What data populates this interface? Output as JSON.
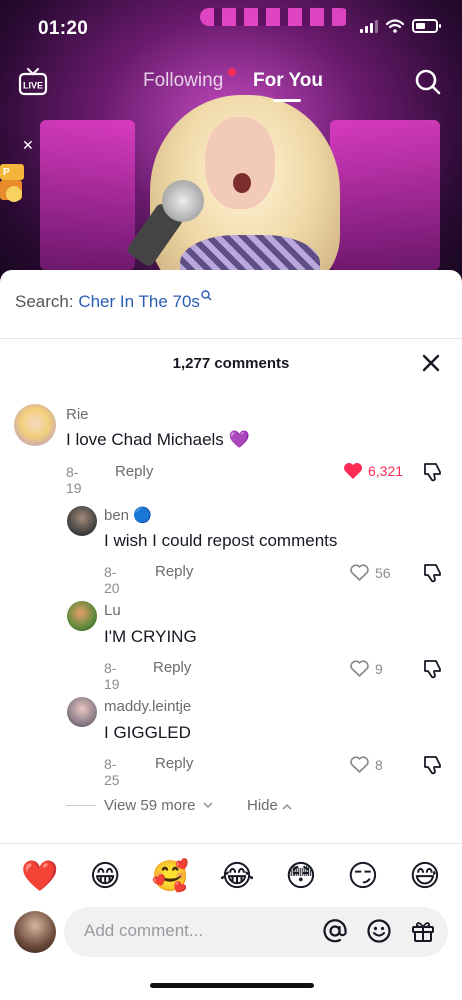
{
  "status_bar": {
    "time": "01:20"
  },
  "top_nav": {
    "live_label": "LIVE",
    "tabs": [
      {
        "label": "Following",
        "has_notification": true
      },
      {
        "label": "For You",
        "active": true
      }
    ]
  },
  "sheet": {
    "search_prefix": "Search:",
    "search_query": "Cher In The 70s",
    "comment_count_label": "1,277 comments",
    "comments": [
      {
        "user": "Rie",
        "text": "I love Chad Michaels 💜",
        "date": "8-19",
        "reply": "Reply",
        "likes": "6,321",
        "liked": true
      },
      {
        "user": "ben 🔵",
        "text": "I wish I could repost comments",
        "date": "8-20",
        "reply": "Reply",
        "likes": "56",
        "liked": false
      },
      {
        "user": "Lu",
        "text": "I'M CRYING",
        "date": "8-19",
        "reply": "Reply",
        "likes": "9",
        "liked": false
      },
      {
        "user": "maddy.leintje",
        "text": "I GIGGLED",
        "date": "8-25",
        "reply": "Reply",
        "likes": "8",
        "liked": false
      }
    ],
    "view_more_label": "View 59 more",
    "hide_label": "Hide"
  },
  "emoji_bar": [
    "❤️",
    "😁",
    "🥰",
    "😂",
    "😳",
    "😏",
    "😅"
  ],
  "composer": {
    "placeholder": "Add comment..."
  },
  "colors": {
    "accent_red": "#fe2c55",
    "link_blue": "#2b5db5"
  }
}
